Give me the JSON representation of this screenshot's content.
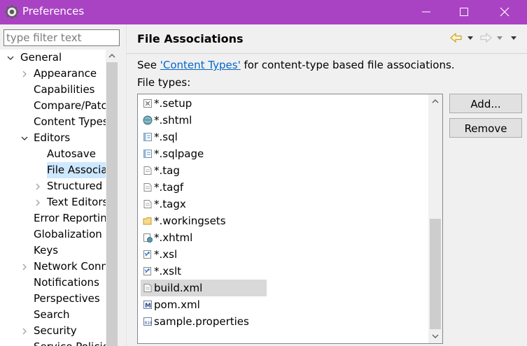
{
  "window": {
    "title": "Preferences"
  },
  "filter": {
    "placeholder": "type filter text"
  },
  "tree": [
    {
      "label": "General",
      "arrow": "down",
      "level": 0
    },
    {
      "label": "Appearance",
      "arrow": "right",
      "level": 1
    },
    {
      "label": "Capabilities",
      "arrow": "none",
      "level": 1
    },
    {
      "label": "Compare/Patch",
      "arrow": "none",
      "level": 1
    },
    {
      "label": "Content Types",
      "arrow": "none",
      "level": 1
    },
    {
      "label": "Editors",
      "arrow": "down",
      "level": 1
    },
    {
      "label": "Autosave",
      "arrow": "none",
      "level": 2
    },
    {
      "label": "File Associations",
      "arrow": "none",
      "level": 2,
      "selected": true
    },
    {
      "label": "Structured Text Editors",
      "arrow": "right",
      "level": 2
    },
    {
      "label": "Text Editors",
      "arrow": "right",
      "level": 2
    },
    {
      "label": "Error Reporting",
      "arrow": "none",
      "level": 1
    },
    {
      "label": "Globalization",
      "arrow": "none",
      "level": 1
    },
    {
      "label": "Keys",
      "arrow": "none",
      "level": 1
    },
    {
      "label": "Network Connections",
      "arrow": "right",
      "level": 1
    },
    {
      "label": "Notifications",
      "arrow": "none",
      "level": 1
    },
    {
      "label": "Perspectives",
      "arrow": "none",
      "level": 1
    },
    {
      "label": "Search",
      "arrow": "none",
      "level": 1
    },
    {
      "label": "Security",
      "arrow": "right",
      "level": 1
    },
    {
      "label": "Service Policies",
      "arrow": "none",
      "level": 1
    }
  ],
  "page": {
    "title": "File Associations",
    "desc_prefix": "See ",
    "desc_link": "'Content Types'",
    "desc_suffix": " for content-type based file associations.",
    "types_label": "File types:"
  },
  "file_types": [
    {
      "name": "*.setup",
      "icon": "setup-icon"
    },
    {
      "name": "*.shtml",
      "icon": "globe-icon"
    },
    {
      "name": "*.sql",
      "icon": "sql-icon"
    },
    {
      "name": "*.sqlpage",
      "icon": "sql-icon"
    },
    {
      "name": "*.tag",
      "icon": "text-file-icon"
    },
    {
      "name": "*.tagf",
      "icon": "text-file-icon"
    },
    {
      "name": "*.tagx",
      "icon": "text-file-icon"
    },
    {
      "name": "*.workingsets",
      "icon": "folder-icon"
    },
    {
      "name": "*.xhtml",
      "icon": "xhtml-icon"
    },
    {
      "name": "*.xsl",
      "icon": "xsl-icon"
    },
    {
      "name": "*.xslt",
      "icon": "xsl-icon"
    },
    {
      "name": "build.xml",
      "icon": "text-file-icon",
      "selected": true
    },
    {
      "name": "pom.xml",
      "icon": "maven-icon"
    },
    {
      "name": "sample.properties",
      "icon": "properties-icon"
    }
  ],
  "buttons": {
    "add": "Add...",
    "remove": "Remove"
  },
  "colors": {
    "titlebar": "#a943c3",
    "link": "#0066cc",
    "tree_selection": "#cde8ff",
    "list_selection": "#d9d9d9"
  }
}
